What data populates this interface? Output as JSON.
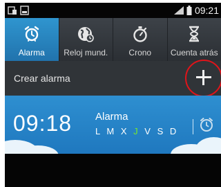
{
  "status_bar": {
    "time": "09:21",
    "icons": [
      "notification-icon",
      "screenshot-icon",
      "signal-icon",
      "battery-icon"
    ]
  },
  "tabs": [
    {
      "label": "Alarma",
      "icon": "alarm-clock-icon",
      "active": true
    },
    {
      "label": "Reloj mund.",
      "icon": "globe-icon",
      "active": false
    },
    {
      "label": "Crono",
      "icon": "stopwatch-icon",
      "active": false
    },
    {
      "label": "Cuenta atrás",
      "icon": "hourglass-icon",
      "active": false
    }
  ],
  "create_alarm": {
    "label": "Crear alarma",
    "add_icon": "plus-icon"
  },
  "alarm": {
    "time": "09:18",
    "name": "Alarma",
    "days": [
      "L",
      "M",
      "X",
      "J",
      "V",
      "S",
      "D"
    ],
    "highlighted_day": "J",
    "toggle_icon": "alarm-clock-icon"
  },
  "colors": {
    "accent_blue": "#2f95cf",
    "tab_bar": "#3a3f44",
    "highlight_day": "#7bea2a",
    "annotation_red": "#e0141a"
  }
}
